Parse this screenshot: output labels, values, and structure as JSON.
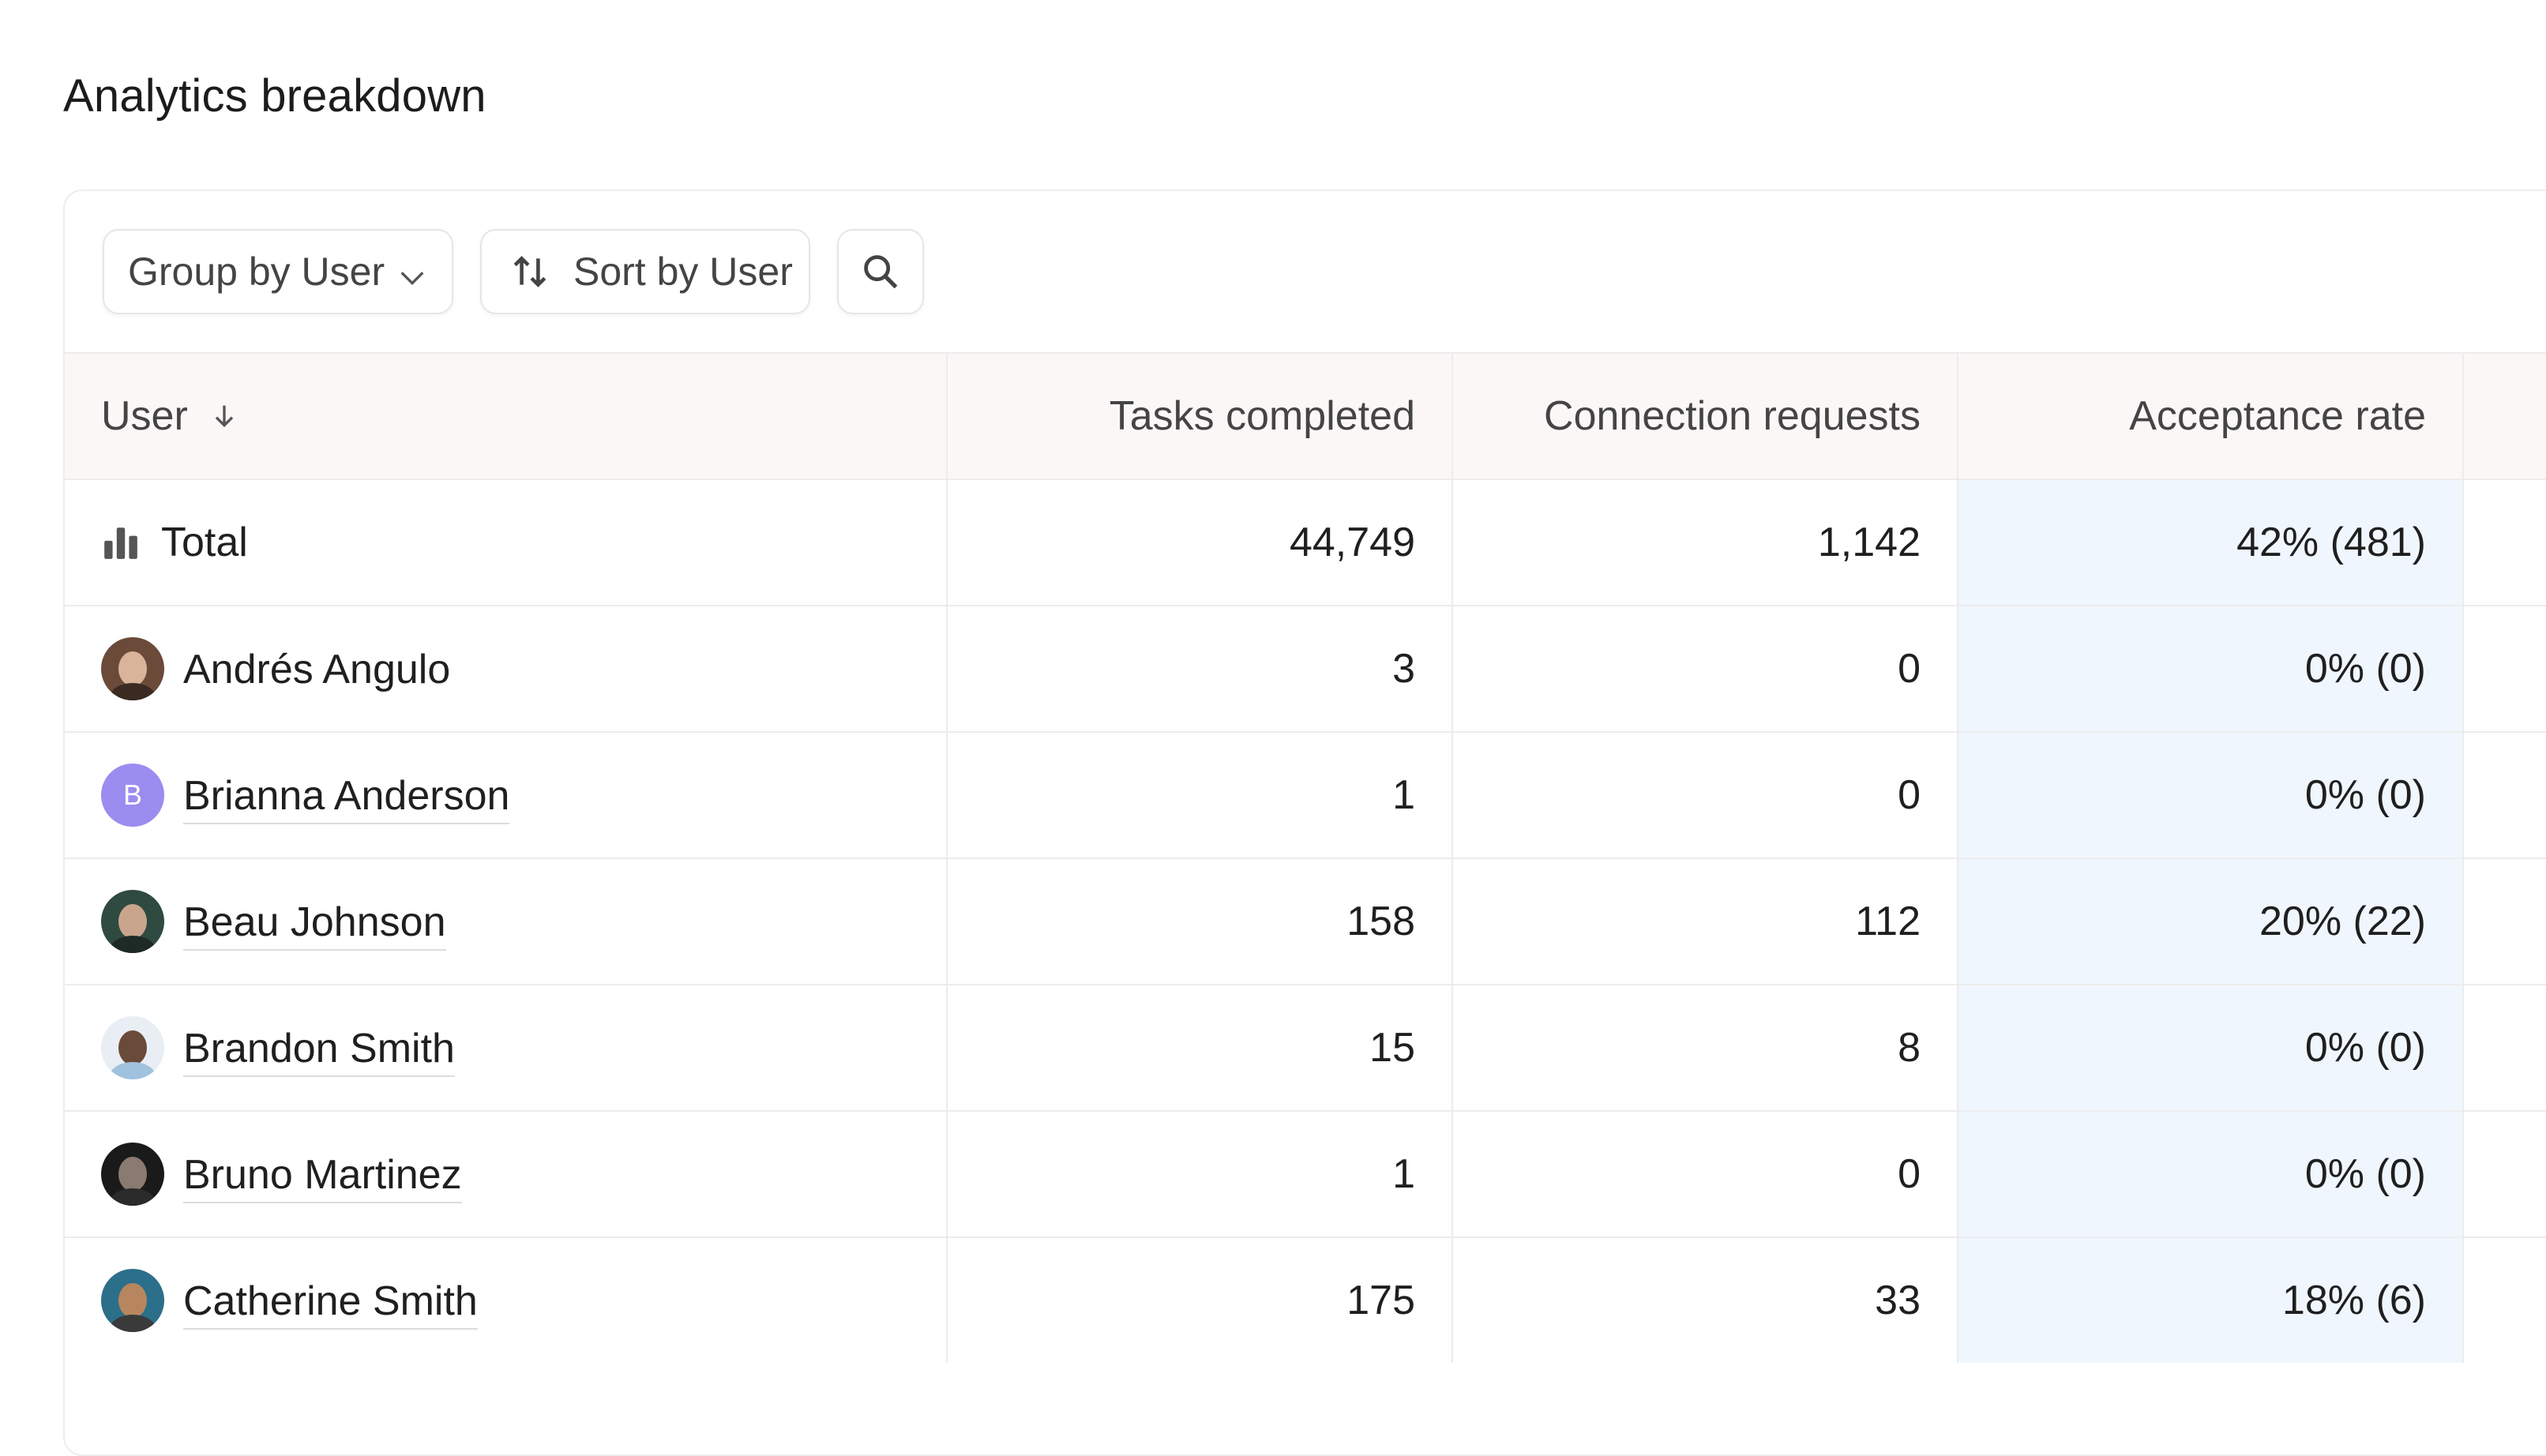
{
  "page": {
    "title": "Analytics breakdown"
  },
  "toolbar": {
    "group_label": "Group by User",
    "sort_label": "Sort by User",
    "icons": {
      "group": "chevron-down-icon",
      "sort": "sort-arrows-icon",
      "search": "search-icon"
    }
  },
  "table": {
    "headers": {
      "user": "User",
      "tasks": "Tasks completed",
      "connections": "Connection requests",
      "acceptance": "Acceptance rate"
    },
    "total": {
      "label": "Total",
      "tasks": "44,749",
      "connections": "1,142",
      "acceptance": "42% (481)"
    },
    "rows": [
      {
        "name": "Andrés Angulo",
        "tasks": "3",
        "connections": "0",
        "acceptance": "0% (0)"
      },
      {
        "name": "Brianna Anderson",
        "avatar_letter": "B",
        "tasks": "1",
        "connections": "0",
        "acceptance": "0% (0)"
      },
      {
        "name": "Beau Johnson",
        "tasks": "158",
        "connections": "112",
        "acceptance": "20% (22)"
      },
      {
        "name": "Brandon Smith",
        "tasks": "15",
        "connections": "8",
        "acceptance": "0% (0)"
      },
      {
        "name": "Bruno Martinez",
        "tasks": "1",
        "connections": "0",
        "acceptance": "0% (0)"
      },
      {
        "name": "Catherine Smith",
        "tasks": "175",
        "connections": "33",
        "acceptance": "18% (6)"
      }
    ]
  },
  "colors": {
    "header_bg": "#fcf7f7",
    "acceptance_bg": "#f0f6fe",
    "letter_avatar": "#9b8cf0"
  }
}
